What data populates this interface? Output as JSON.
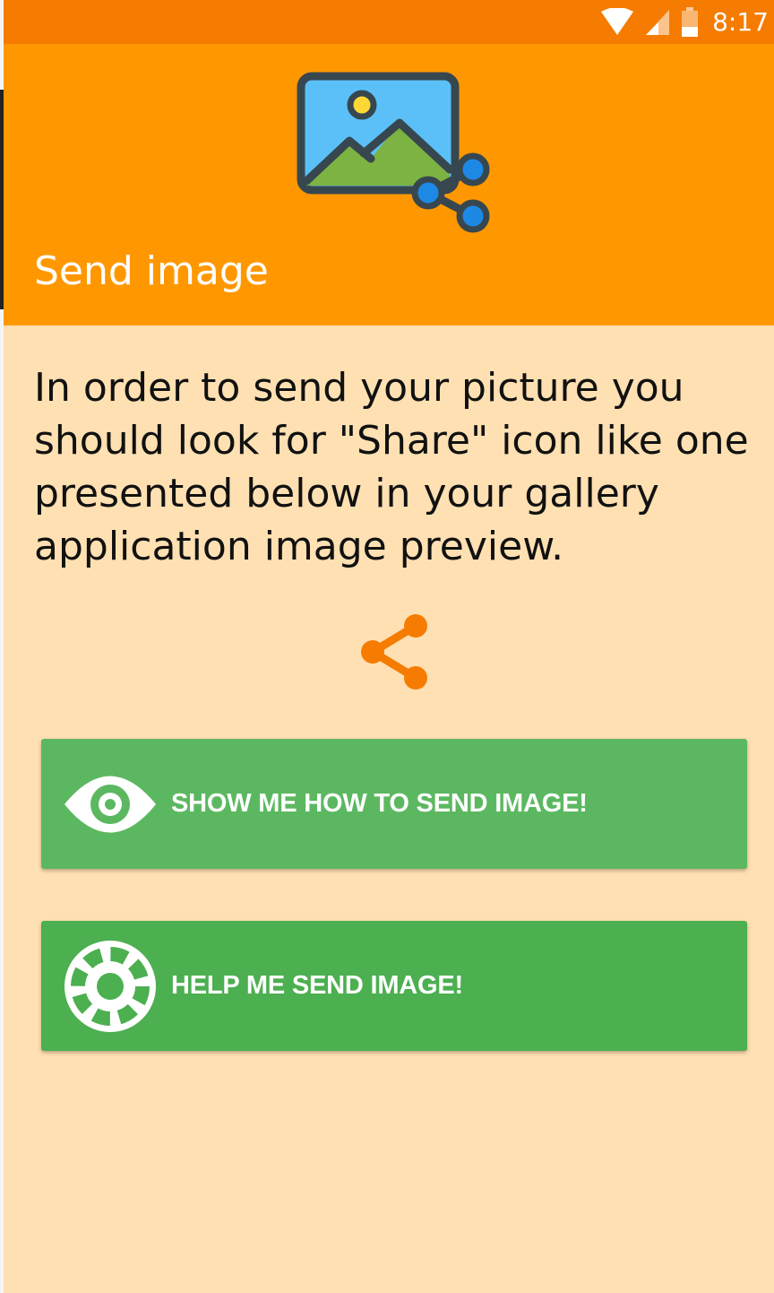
{
  "status_bar": {
    "time": "8:17",
    "icons": [
      "wifi-icon",
      "cell-signal-icon",
      "battery-icon"
    ]
  },
  "header": {
    "title": "Send image",
    "illustration": "image-share-illustration"
  },
  "main": {
    "instructions": "In order to send your picture you should look for \"Share\" icon like one presented below in your gallery application image preview.",
    "sample_icon": "share-icon"
  },
  "buttons": {
    "show_label": "SHOW ME HOW TO SEND IMAGE!",
    "show_icon": "eye-icon",
    "help_label": "HELP ME SEND IMAGE!",
    "help_icon": "lifebuoy-icon"
  },
  "colors": {
    "status_bar": "#f57c00",
    "header": "#ff9800",
    "background": "#ffe0b2",
    "button_show": "#5cb860",
    "button_help": "#4caf50",
    "share_accent": "#f57c00"
  }
}
